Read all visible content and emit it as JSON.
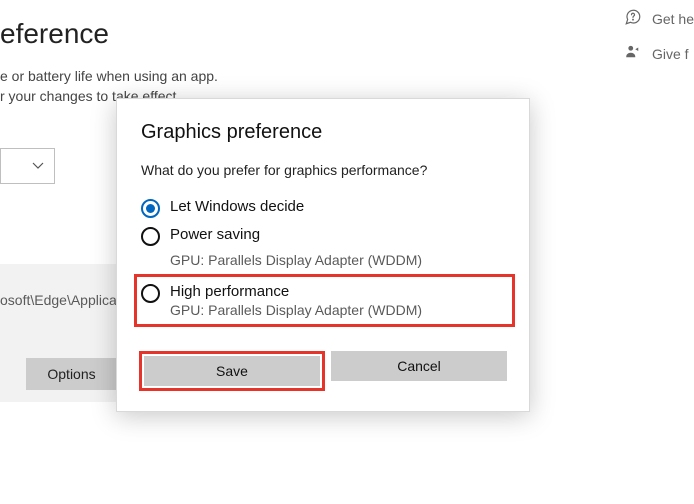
{
  "background": {
    "title_partial": "eference",
    "desc_line1": "e or battery life when using an app.",
    "desc_line2": "r your changes to take effect.",
    "app_path_partial": "osoft\\Edge\\Applicati",
    "options_button": "Options",
    "right_links": {
      "get_help": "Get he",
      "give_feedback": "Give f"
    }
  },
  "dialog": {
    "title": "Graphics preference",
    "question": "What do you prefer for graphics performance?",
    "options": [
      {
        "label": "Let Windows decide",
        "sub": "",
        "checked": true
      },
      {
        "label": "Power saving",
        "sub": "GPU: Parallels Display Adapter (WDDM)",
        "checked": false
      },
      {
        "label": "High performance",
        "sub": "GPU: Parallels Display Adapter (WDDM)",
        "checked": false
      }
    ],
    "save": "Save",
    "cancel": "Cancel"
  }
}
